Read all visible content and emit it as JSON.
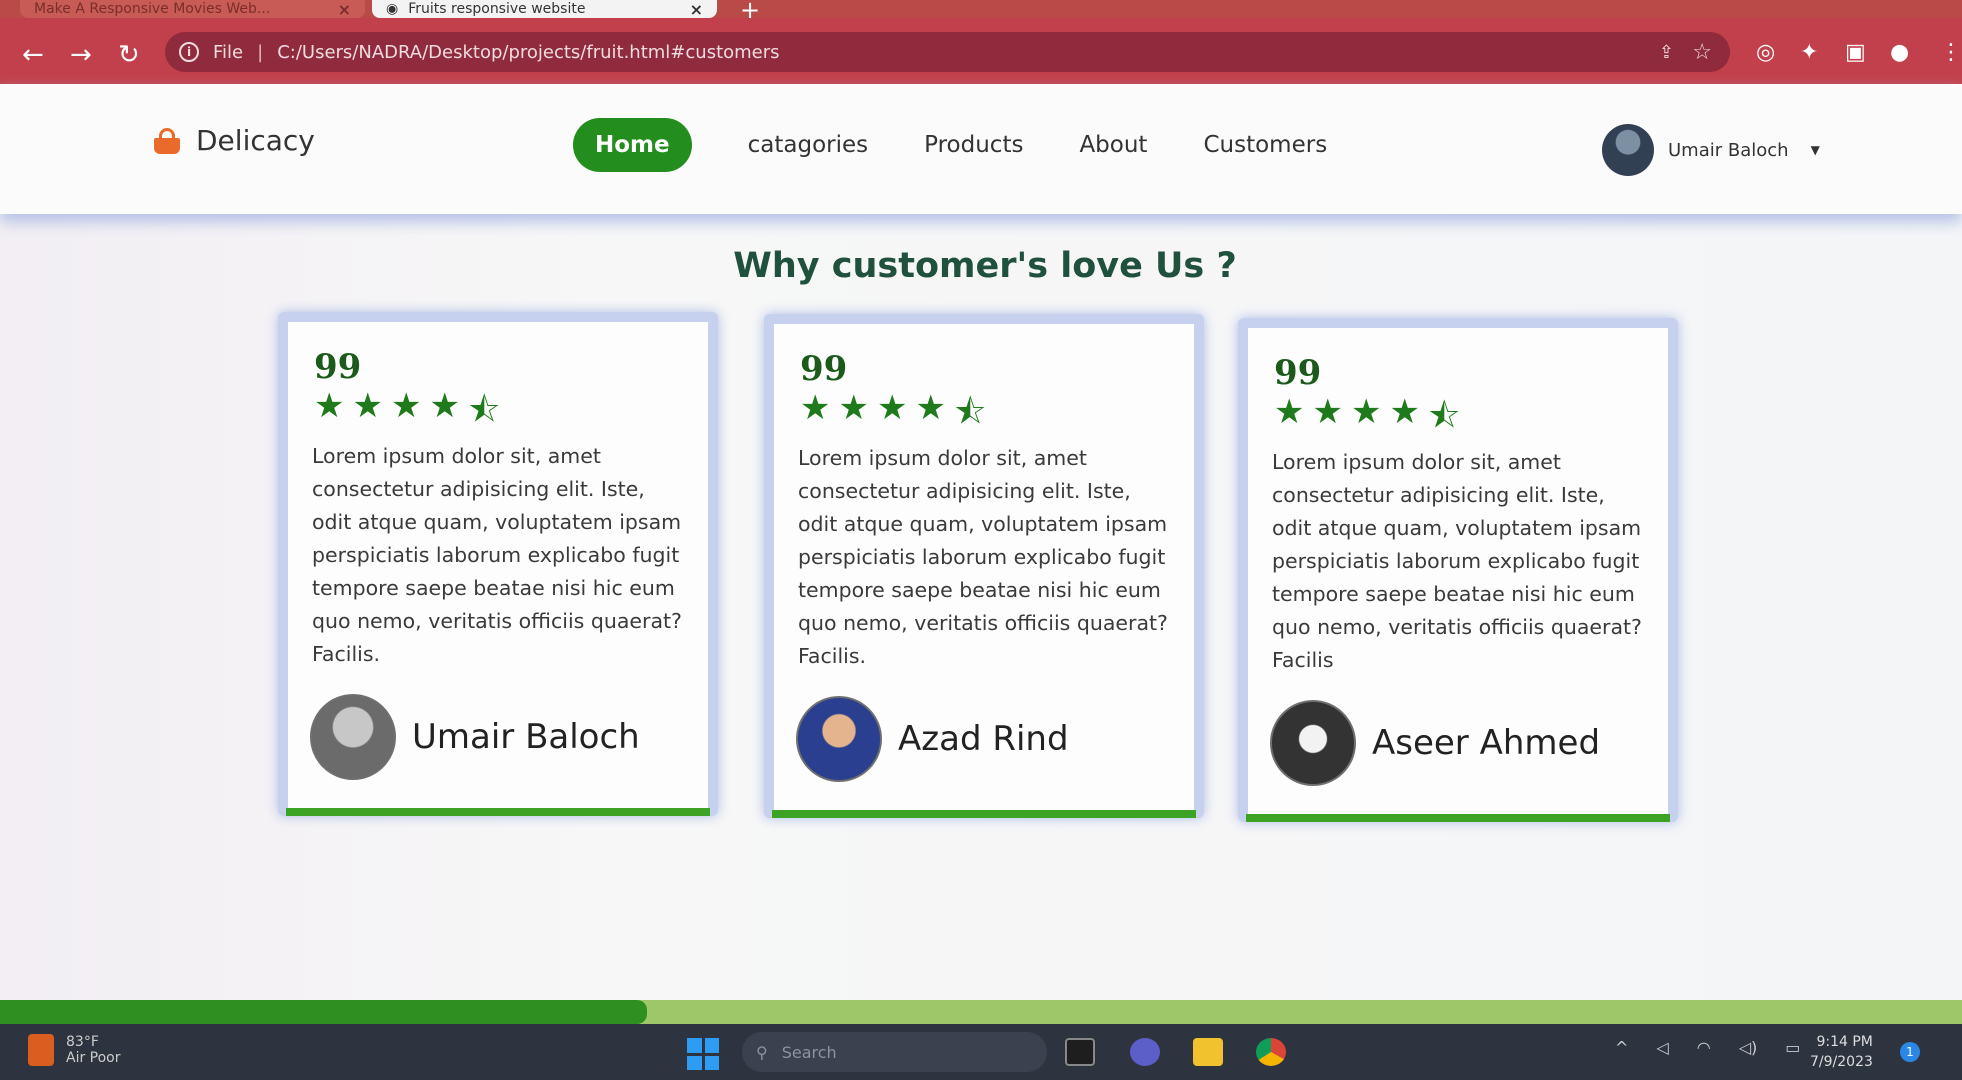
{
  "browser": {
    "tabs": [
      {
        "title": "Make A Responsive Movies Web..."
      },
      {
        "title": "Fruits responsive website"
      }
    ],
    "tab_close": "×",
    "new_tab": "+",
    "file_label": "File",
    "url": "C:/Users/NADRA/Desktop/projects/fruit.html#customers"
  },
  "navbar": {
    "logo_text": "Delicacy",
    "links": [
      "Home",
      "catagories",
      "Products",
      "About",
      "Customers"
    ],
    "user_name": "Umair Baloch"
  },
  "section": {
    "title": "Why customer's love Us ?"
  },
  "reviews": [
    {
      "quote_mark": "99",
      "rating": 4.5,
      "text": "Lorem ipsum dolor sit, amet consectetur adipisicing elit. Iste, odit atque quam, voluptatem ipsam perspiciatis laborum explicabo fugit tempore saepe beatae nisi hic eum quo nemo, veritatis officiis quaerat? Facilis.",
      "name": "Umair Baloch"
    },
    {
      "quote_mark": "99",
      "rating": 4.5,
      "text": "Lorem ipsum dolor sit, amet consectetur adipisicing elit. Iste, odit atque quam, voluptatem ipsam perspiciatis laborum explicabo fugit tempore saepe beatae nisi hic eum quo nemo, veritatis officiis quaerat? Facilis.",
      "name": "Azad Rind"
    },
    {
      "quote_mark": "99",
      "rating": 4.5,
      "text": "Lorem ipsum dolor sit, amet consectetur adipisicing elit. Iste, odit atque quam, voluptatem ipsam perspiciatis laborum explicabo fugit tempore saepe beatae nisi hic eum quo nemo, veritatis officiis quaerat? Facilis",
      "name": "Aseer Ahmed"
    }
  ],
  "scroll_progress": 0.33,
  "taskbar": {
    "weather_temp": "83°F",
    "weather_desc": "Air Poor",
    "search_placeholder": "Search",
    "time": "9:14 PM",
    "date": "7/9/2023",
    "notification_count": "1"
  },
  "colors": {
    "accent_green": "#238d1e",
    "card_border": "#c6d0ef",
    "browser_red": "#c2404c"
  }
}
